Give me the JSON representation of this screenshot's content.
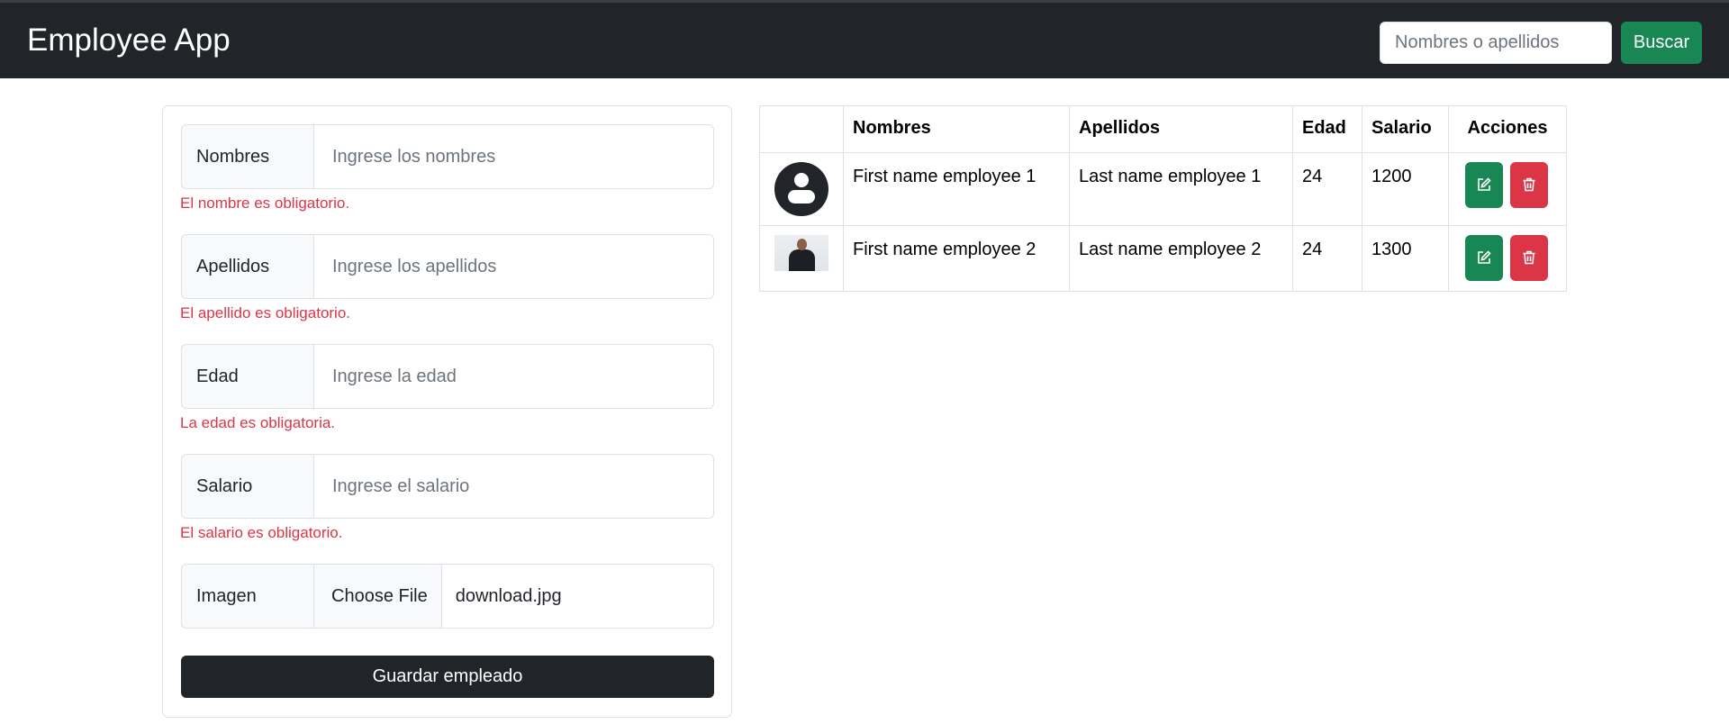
{
  "navbar": {
    "brand": "Employee App",
    "search_placeholder": "Nombres o apellidos",
    "search_button": "Buscar"
  },
  "form": {
    "fields": [
      {
        "label": "Nombres",
        "placeholder": "Ingrese los nombres",
        "error": "El nombre es obligatorio."
      },
      {
        "label": "Apellidos",
        "placeholder": "Ingrese los apellidos",
        "error": "El apellido es obligatorio."
      },
      {
        "label": "Edad",
        "placeholder": "Ingrese la edad",
        "error": "La edad es obligatoria."
      },
      {
        "label": "Salario",
        "placeholder": "Ingrese el salario",
        "error": "El salario es obligatorio."
      }
    ],
    "image": {
      "label": "Imagen",
      "button": "Choose File",
      "filename": "download.jpg"
    },
    "submit": "Guardar empleado"
  },
  "table": {
    "headers": [
      "",
      "Nombres",
      "Apellidos",
      "Edad",
      "Salario",
      "Acciones"
    ],
    "rows": [
      {
        "avatar": "default-user-icon",
        "nombres": "First name employee 1",
        "apellidos": "Last name employee 1",
        "edad": "24",
        "salario": "1200"
      },
      {
        "avatar": "employee-photo",
        "nombres": "First name employee 2",
        "apellidos": "Last name employee 2",
        "edad": "24",
        "salario": "1300"
      }
    ],
    "actions": {
      "edit_icon": "edit-icon",
      "delete_icon": "trash-icon"
    }
  },
  "colors": {
    "navbar": "#212529",
    "success": "#198754",
    "danger": "#dc3545",
    "dark_button": "#212529"
  }
}
